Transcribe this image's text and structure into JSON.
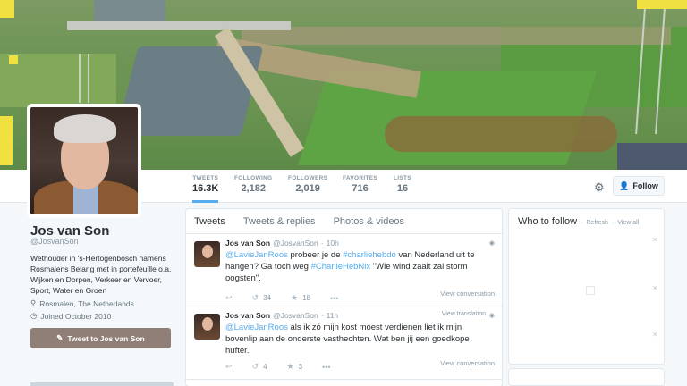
{
  "profile": {
    "name": "Jos van Son",
    "handle": "@JosvanSon",
    "bio": "Wethouder in 's-Hertogenbosch namens Rosmalens Belang met in portefeuille o.a. Wijken en Dorpen, Verkeer en Vervoer, Sport, Water en Groen",
    "location": "Rosmalen, The Netherlands",
    "joined": "Joined October 2010",
    "tweet_to_label": "Tweet to Jos van Son"
  },
  "nav": {
    "stats": [
      {
        "label": "TWEETS",
        "value": "16.3K"
      },
      {
        "label": "FOLLOWING",
        "value": "2,182"
      },
      {
        "label": "FOLLOWERS",
        "value": "2,019"
      },
      {
        "label": "FAVORITES",
        "value": "716"
      },
      {
        "label": "LISTS",
        "value": "16"
      }
    ],
    "follow_label": "Follow"
  },
  "timeline": {
    "tabs": [
      "Tweets",
      "Tweets & replies",
      "Photos & videos"
    ],
    "tweets": [
      {
        "name": "Jos van Son",
        "handle": "@JosvanSon",
        "time": "10h",
        "t1": "@LavieJanRoos",
        "t2": " probeer je de ",
        "t3": "#charliehebdo",
        "t4": " van Nederland uit te hangen? Ga toch weg ",
        "t5": "#CharlieHebNix",
        "t6": " \"Wie wind zaait zal storm oogsten\".",
        "retweets": "34",
        "favorites": "18",
        "view_conversation": "View conversation"
      },
      {
        "name": "Jos van Son",
        "handle": "@JosvanSon",
        "time": "11h",
        "view_translation": "View translation",
        "t1": "@LavieJanRoos",
        "t2": " als ik zó mijn kost moest verdienen liet ik mijn bovenlip aan de onderste vasthechten. Wat ben jij een goedkope hufter.",
        "retweets": "4",
        "favorites": "3",
        "view_conversation": "View conversation"
      }
    ]
  },
  "who_to_follow": {
    "title": "Who to follow",
    "refresh": "Refresh",
    "view_all": "View all"
  }
}
